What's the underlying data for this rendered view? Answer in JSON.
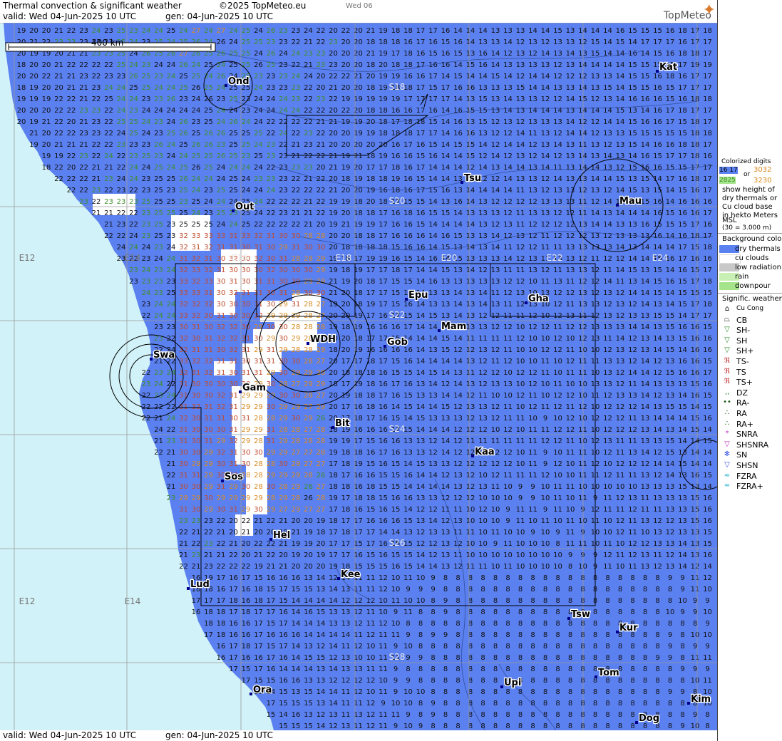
{
  "header": {
    "title": "Thermal convection & significant weather",
    "copyright": "©2025 TopMeteo.eu",
    "next_day": "Wed 06",
    "valid": "valid:  Wed  04-Jun-2025  10 UTC",
    "gen": "gen: 04-Jun-2025 10 UTC",
    "logo": "TopMeteo"
  },
  "scale": {
    "label": "400 km"
  },
  "colors": {
    "sea": "#d1f2f8",
    "dry_thermals": "#5b80f0",
    "cu_clouds": "#ffffff",
    "low_radiation": "#c8c8c8",
    "rain": "#c9f0b4",
    "downpour": "#a6e48c",
    "grid": "#9a9a9a",
    "digit_green": "#3d8f2a",
    "digit_orange": "#d98a1f",
    "digit_red": "#c04a2a",
    "digit_black": "#111111"
  },
  "cities": [
    {
      "name": "Ond"
    },
    {
      "name": "Kat"
    },
    {
      "name": "Tsu"
    },
    {
      "name": "Mau"
    },
    {
      "name": "Out"
    },
    {
      "name": "Epu"
    },
    {
      "name": "Gha"
    },
    {
      "name": "Mam"
    },
    {
      "name": "WDH"
    },
    {
      "name": "Gob"
    },
    {
      "name": "Swa"
    },
    {
      "name": "Gam"
    },
    {
      "name": "Bit"
    },
    {
      "name": "Kaa"
    },
    {
      "name": "Sos"
    },
    {
      "name": "Hel"
    },
    {
      "name": "Kee"
    },
    {
      "name": "Lud"
    },
    {
      "name": "Tsw"
    },
    {
      "name": "Kur"
    },
    {
      "name": "Tom"
    },
    {
      "name": "Upi"
    },
    {
      "name": "Ora"
    },
    {
      "name": "Kim"
    },
    {
      "name": "Dog"
    }
  ],
  "grid_labels": {
    "lat": [
      "S18",
      "S20",
      "S22",
      "S24",
      "S26",
      "S28"
    ],
    "lon": [
      "E12",
      "E14",
      "E16",
      "E18",
      "E20",
      "E22",
      "E24"
    ]
  },
  "legend": {
    "colorized_title": "Colorized digits",
    "sample_a": "16 17",
    "sample_or": "or",
    "sample_b": "3032",
    "sample_c": "2825",
    "sample_d": "3230",
    "desc": [
      "show height of",
      "dry thermals or",
      "Cu cloud base",
      "in hekto Meters",
      "MSL",
      "(30 = 3.000 m)"
    ],
    "bg_title": "Background color",
    "bg_items": [
      "dry thermals",
      "cu clouds",
      "low radiation",
      "rain",
      "downpour"
    ],
    "weather_title": "Signific. weather",
    "weather_items": [
      {
        "label": "Cu Cong",
        "icon": "cu-cong-icon"
      },
      {
        "label": "CB",
        "icon": "cb-icon"
      },
      {
        "label": "SH-",
        "icon": "shower-light-icon"
      },
      {
        "label": "SH",
        "icon": "shower-icon"
      },
      {
        "label": "SH+",
        "icon": "shower-heavy-icon"
      },
      {
        "label": "TS-",
        "icon": "thunderstorm-light-icon"
      },
      {
        "label": "TS",
        "icon": "thunderstorm-icon"
      },
      {
        "label": "TS+",
        "icon": "thunderstorm-heavy-icon"
      },
      {
        "label": "DZ",
        "icon": "drizzle-icon"
      },
      {
        "label": "RA-",
        "icon": "rain-light-icon"
      },
      {
        "label": "RA",
        "icon": "rain-icon"
      },
      {
        "label": "RA+",
        "icon": "rain-heavy-icon"
      },
      {
        "label": "SNRA",
        "icon": "snow-rain-icon"
      },
      {
        "label": "SHSNRA",
        "icon": "snow-rain-shower-icon"
      },
      {
        "label": "SN",
        "icon": "snow-icon"
      },
      {
        "label": "SHSN",
        "icon": "snow-shower-icon"
      },
      {
        "label": "FZRA",
        "icon": "freezing-rain-icon"
      },
      {
        "label": "FZRA+",
        "icon": "freezing-rain-heavy-icon"
      }
    ]
  }
}
